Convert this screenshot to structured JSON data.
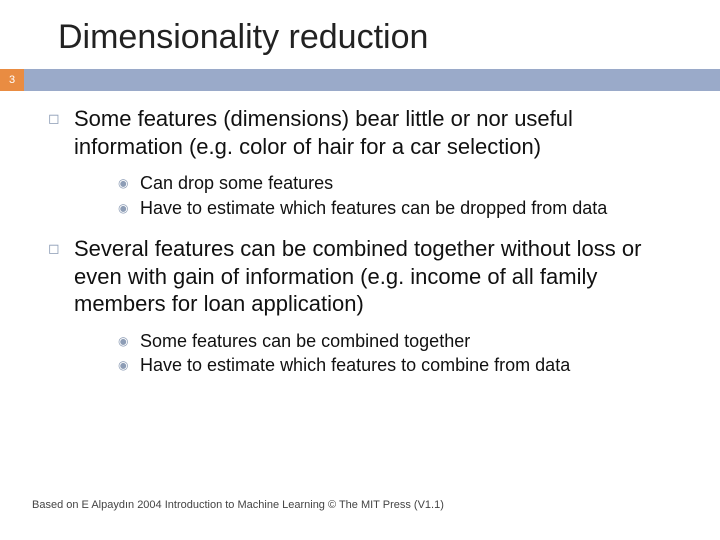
{
  "title": "Dimensionality reduction",
  "pageNumber": "3",
  "bullets": [
    {
      "text": "Some features (dimensions) bear little or nor useful information (e.g. color of hair for a car selection)",
      "sub": [
        "Can drop some features",
        "Have to estimate which features can be dropped from data"
      ]
    },
    {
      "text": "Several features can be combined together without loss or even with gain of information (e.g. income of all family members for loan application)",
      "sub": [
        "Some features can be combined together",
        "Have to estimate which features to combine from data"
      ]
    }
  ],
  "footer": "Based on E Alpaydın 2004 Introduction to Machine Learning © The MIT Press (V1.1)"
}
